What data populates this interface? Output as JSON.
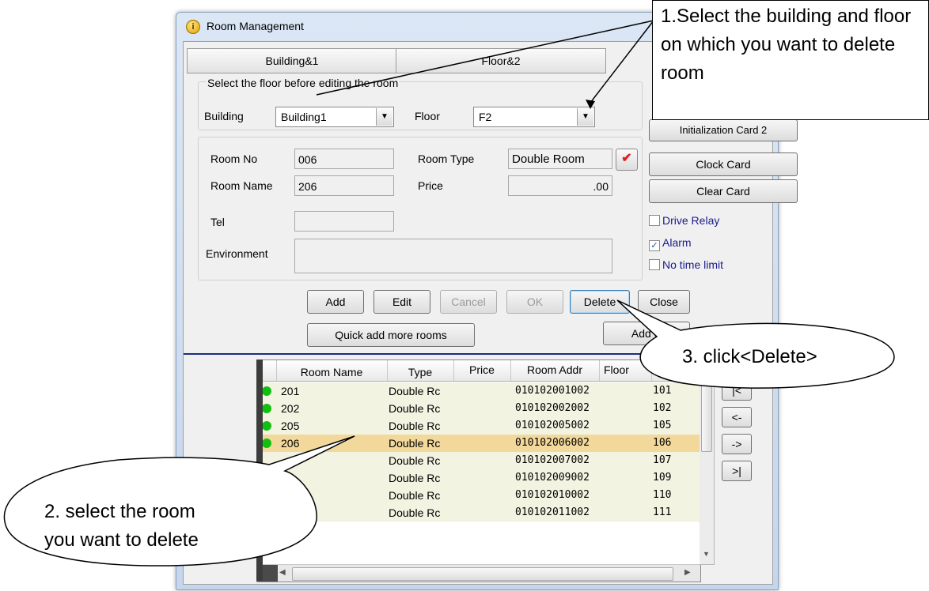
{
  "window": {
    "title": "Room Management"
  },
  "tabs": [
    {
      "label": "Building&1"
    },
    {
      "label": "Floor&2"
    }
  ],
  "floor_select": {
    "group_title": "Select the floor before editing the room",
    "building_label": "Building",
    "building_value": "Building1",
    "floor_label": "Floor",
    "floor_value": "F2"
  },
  "room_form": {
    "room_no_label": "Room No",
    "room_no_value": "006",
    "room_type_label": "Room Type",
    "room_type_value": "Double Room",
    "room_name_label": "Room Name",
    "room_name_value": "206",
    "price_label": "Price",
    "price_value": ".00",
    "tel_label": "Tel",
    "tel_value": "",
    "environment_label": "Environment",
    "environment_value": ""
  },
  "side_buttons": {
    "init_card2": "Initialization Card 2",
    "clock_card": "Clock Card",
    "clear_card": "Clear Card"
  },
  "options": [
    {
      "label": "Drive Relay",
      "checked": false
    },
    {
      "label": "Alarm",
      "checked": true
    },
    {
      "label": "No time limit",
      "checked": false
    }
  ],
  "actions": {
    "add": "Add",
    "edit": "Edit",
    "cancel": "Cancel",
    "ok": "OK",
    "delete": "Delete",
    "close": "Close",
    "quick_add": "Quick add more rooms",
    "add_s": "Add S"
  },
  "grid": {
    "columns": [
      "Room Name",
      "Type",
      "Price",
      "Room Addr",
      "Floor"
    ],
    "rows": [
      {
        "name": "201",
        "type": "Double Rc",
        "price": "",
        "addr": "010102001002",
        "code": "101",
        "dot": true,
        "selected": false
      },
      {
        "name": "202",
        "type": "Double Rc",
        "price": "",
        "addr": "010102002002",
        "code": "102",
        "dot": true,
        "selected": false
      },
      {
        "name": "205",
        "type": "Double Rc",
        "price": "",
        "addr": "010102005002",
        "code": "105",
        "dot": true,
        "selected": false
      },
      {
        "name": "206",
        "type": "Double Rc",
        "price": "",
        "addr": "010102006002",
        "code": "106",
        "dot": true,
        "selected": true
      },
      {
        "name": "",
        "type": "Double Rc",
        "price": "",
        "addr": "010102007002",
        "code": "107",
        "dot": false,
        "selected": false
      },
      {
        "name": "",
        "type": "Double Rc",
        "price": "",
        "addr": "010102009002",
        "code": "109",
        "dot": false,
        "selected": false
      },
      {
        "name": "",
        "type": "Double Rc",
        "price": "",
        "addr": "010102010002",
        "code": "110",
        "dot": false,
        "selected": false
      },
      {
        "name": "",
        "type": "Double Rc",
        "price": "",
        "addr": "010102011002",
        "code": "111",
        "dot": false,
        "selected": false
      }
    ]
  },
  "nav_buttons": [
    "|<",
    "<-",
    "->",
    ">|"
  ],
  "annotations": {
    "step1": "1.Select the building and floor on which you want to delete room",
    "step2_line1": "2. select the room",
    "step2_line2": "you want to delete",
    "step3": "3. click<Delete>"
  }
}
